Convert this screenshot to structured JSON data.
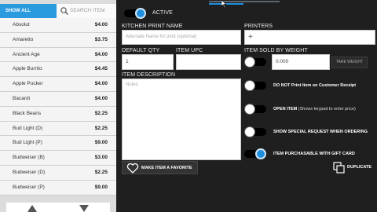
{
  "filter": {
    "show_all": "SHOW ALL",
    "search_placeholder": "SEARCH ITEM"
  },
  "items": [
    {
      "name": "Absolut",
      "price": "$4.00"
    },
    {
      "name": "Amaretto",
      "price": "$3.75"
    },
    {
      "name": "Ancient Age",
      "price": "$4.00"
    },
    {
      "name": "Apple Burrito",
      "price": "$4.45"
    },
    {
      "name": "Apple Pucker",
      "price": "$4.00"
    },
    {
      "name": "Bacardi",
      "price": "$4.00"
    },
    {
      "name": "Black Beans",
      "price": "$2.25"
    },
    {
      "name": "Bud Light (D)",
      "price": "$2.25"
    },
    {
      "name": "Bud Light (P)",
      "price": "$9.00"
    },
    {
      "name": "Budweiser (B)",
      "price": "$3.00"
    },
    {
      "name": "Budweiser (D)",
      "price": "$2.25"
    },
    {
      "name": "Budweiser (P)",
      "price": "$9.00"
    }
  ],
  "form": {
    "active_label": "ACTIVE",
    "active_on": true,
    "kitchen_print_name_label": "KITCHEN PRINT NAME",
    "kitchen_print_name_placeholder": "Alternate Name for print (optional)",
    "printers_label": "PRINTERS",
    "printers_add": "+",
    "default_qty_label": "DEFAULT QTY",
    "default_qty_value": "1",
    "item_upc_label": "ITEM UPC",
    "item_sold_by_weight_label": "ITEM SOLD BY WEIGHT",
    "weight_value": "0.000",
    "tare_weight_label": "TARE WEIGHT",
    "item_description_label": "ITEM DESCRIPTION",
    "notes_placeholder": "Notes",
    "options": [
      {
        "label": "DO NOT Print Item on Customer Receipt",
        "note": "",
        "on": false
      },
      {
        "label": "OPEN ITEM",
        "note": "(Shows keypad to enter price)",
        "on": false
      },
      {
        "label": "SHOW SPECIAL REQUEST WHEN ORDERING",
        "note": "",
        "on": false
      },
      {
        "label": "ITEM PURCHASABLE WITH GIFT CARD",
        "note": "",
        "on": true
      }
    ],
    "favorite_label": "MAKE ITEM A FAVORITE",
    "duplicate_label": "DUPLICATE"
  },
  "colors": {
    "accent": "#1f8fe0",
    "list_bg": "#f4f4f4",
    "panel_bg": "#1f1f1f"
  }
}
